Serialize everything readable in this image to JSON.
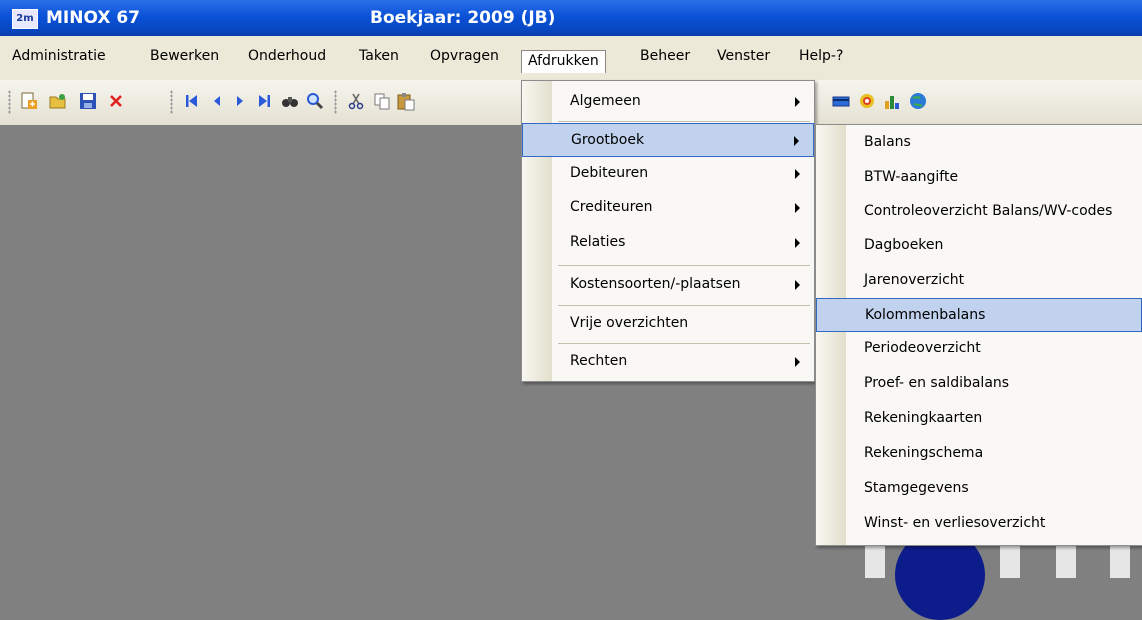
{
  "window": {
    "icon_text": "2m",
    "app_name": "MINOX  67",
    "fiscal_year": "Boekjaar: 2009  (JB)"
  },
  "menubar": {
    "items": [
      "Administratie",
      "Bewerken",
      "Onderhoud",
      "Taken",
      "Opvragen",
      "Afdrukken",
      "Beheer",
      "Venster",
      "Help-?"
    ],
    "active": "Afdrukken"
  },
  "toolbar": {
    "icons": [
      "new-icon",
      "open-icon",
      "save-icon",
      "delete-icon",
      "first-icon",
      "previous-icon",
      "next-icon",
      "last-icon",
      "find-icon",
      "search-icon",
      "cut-icon",
      "copy-icon",
      "paste-icon",
      "card-icon",
      "settings-icon",
      "chart-icon",
      "globe-icon"
    ]
  },
  "afdrukken_menu": {
    "items": [
      {
        "label": "Algemeen",
        "submenu": true
      },
      {
        "label": "Grootboek",
        "submenu": true,
        "highlighted": true
      },
      {
        "label": "Debiteuren",
        "submenu": true
      },
      {
        "label": "Crediteuren",
        "submenu": true
      },
      {
        "label": "Relaties",
        "submenu": true
      },
      {
        "label": "Kostensoorten/-plaatsen",
        "submenu": true
      },
      {
        "label": "Vrije overzichten",
        "submenu": false
      },
      {
        "label": "Rechten",
        "submenu": true
      }
    ]
  },
  "grootboek_submenu": {
    "items": [
      {
        "label": "Balans"
      },
      {
        "label": "BTW-aangifte"
      },
      {
        "label": "Controleoverzicht Balans/WV-codes"
      },
      {
        "label": "Dagboeken"
      },
      {
        "label": "Jarenoverzicht"
      },
      {
        "label": "Kolommenbalans",
        "highlighted": true
      },
      {
        "label": "Periodeoverzicht"
      },
      {
        "label": "Proef- en saldibalans"
      },
      {
        "label": "Rekeningkaarten"
      },
      {
        "label": "Rekeningschema"
      },
      {
        "label": "Stamgegevens"
      },
      {
        "label": "Winst- en verliesoverzicht"
      }
    ]
  },
  "colors": {
    "titlebar": "#0a52d8",
    "highlight": "#c1d2ee",
    "highlight_border": "#316ac5",
    "workspace": "#808080"
  }
}
